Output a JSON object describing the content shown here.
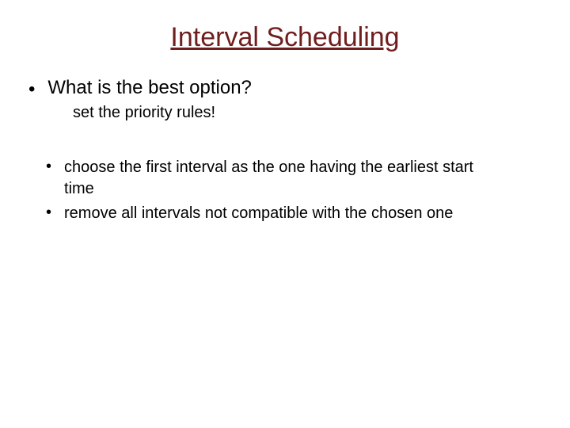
{
  "title": "Interval Scheduling",
  "question": "What is the best option?",
  "subline": "set the priority rules!",
  "items": [
    "choose the first interval as the one having the earliest start time",
    "remove all intervals not compatible with the chosen one"
  ]
}
